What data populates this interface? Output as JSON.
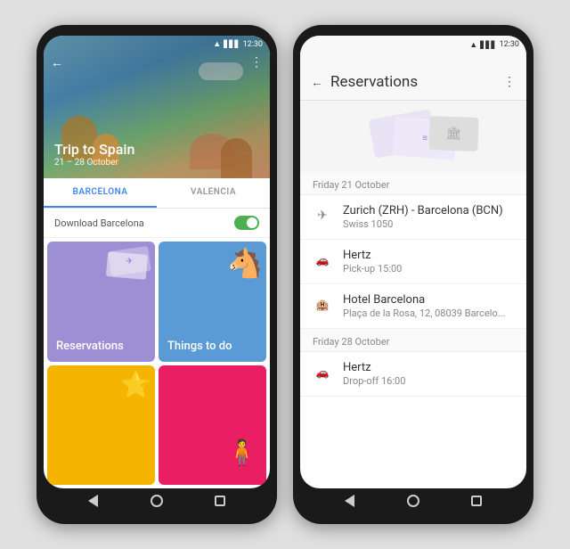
{
  "left_phone": {
    "status": {
      "time": "12:30",
      "wifi": true,
      "signal": true,
      "battery": true
    },
    "hero": {
      "title": "Trip to Spain",
      "subtitle": "21 – 28 October",
      "back_icon": "←",
      "more_icon": "⋮"
    },
    "tabs": [
      {
        "label": "BARCELONA",
        "active": true
      },
      {
        "label": "VALENCIA",
        "active": false
      }
    ],
    "download_row": {
      "label": "Download Barcelona",
      "toggle_on": true
    },
    "tiles": [
      {
        "id": "reservations",
        "label": "Reservations",
        "color": "#9c8fd4"
      },
      {
        "id": "things-to-do",
        "label": "Things to do",
        "color": "#5b9bd5"
      },
      {
        "id": "saved",
        "label": "",
        "color": "#f4b400"
      },
      {
        "id": "local",
        "label": "",
        "color": "#e91e63"
      }
    ],
    "nav": {
      "back": "◁",
      "home": "○",
      "recent": "□"
    }
  },
  "right_phone": {
    "status": {
      "time": "12:30",
      "wifi": true,
      "signal": true,
      "battery": true
    },
    "header": {
      "title": "Reservations",
      "back_icon": "←",
      "more_icon": "⋮"
    },
    "sections": [
      {
        "date": "Friday 21 October",
        "items": [
          {
            "icon": "✈",
            "icon_type": "flight",
            "title": "Zurich (ZRH) - Barcelona (BCN)",
            "subtitle": "Swiss 1050"
          },
          {
            "icon": "🚗",
            "icon_type": "car",
            "title": "Hertz",
            "subtitle": "Pick-up 15:00"
          },
          {
            "icon": "🏨",
            "icon_type": "hotel",
            "title": "Hotel Barcelona",
            "subtitle": "Plaça de la Rosa, 12, 08039 Barcelo..."
          }
        ]
      },
      {
        "date": "Friday 28 October",
        "items": [
          {
            "icon": "🚗",
            "icon_type": "car",
            "title": "Hertz",
            "subtitle": "Drop-off 16:00"
          }
        ]
      }
    ],
    "nav": {
      "back": "◁",
      "home": "○",
      "recent": "□"
    }
  }
}
